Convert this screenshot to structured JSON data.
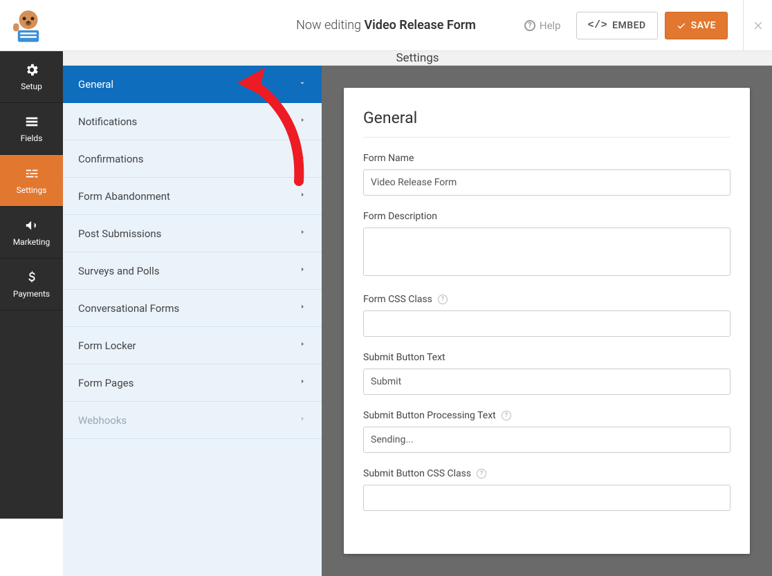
{
  "header": {
    "now_editing_prefix": "Now editing",
    "form_title": "Video Release Form",
    "help_label": "Help",
    "embed_label": "EMBED",
    "save_label": "SAVE"
  },
  "leftnav": {
    "items": [
      {
        "label": "Setup"
      },
      {
        "label": "Fields"
      },
      {
        "label": "Settings"
      },
      {
        "label": "Marketing"
      },
      {
        "label": "Payments"
      }
    ]
  },
  "settings": {
    "title": "Settings",
    "sidebar": [
      {
        "label": "General",
        "active": true
      },
      {
        "label": "Notifications"
      },
      {
        "label": "Confirmations"
      },
      {
        "label": "Form Abandonment"
      },
      {
        "label": "Post Submissions"
      },
      {
        "label": "Surveys and Polls"
      },
      {
        "label": "Conversational Forms"
      },
      {
        "label": "Form Locker"
      },
      {
        "label": "Form Pages"
      },
      {
        "label": "Webhooks",
        "disabled": true
      }
    ]
  },
  "panel": {
    "heading": "General",
    "form_name_label": "Form Name",
    "form_name_value": "Video Release Form",
    "form_description_label": "Form Description",
    "form_description_value": "",
    "form_css_class_label": "Form CSS Class",
    "form_css_class_value": "",
    "submit_text_label": "Submit Button Text",
    "submit_text_value": "Submit",
    "submit_processing_label": "Submit Button Processing Text",
    "submit_processing_value": "Sending...",
    "submit_css_class_label": "Submit Button CSS Class",
    "submit_css_class_value": ""
  }
}
